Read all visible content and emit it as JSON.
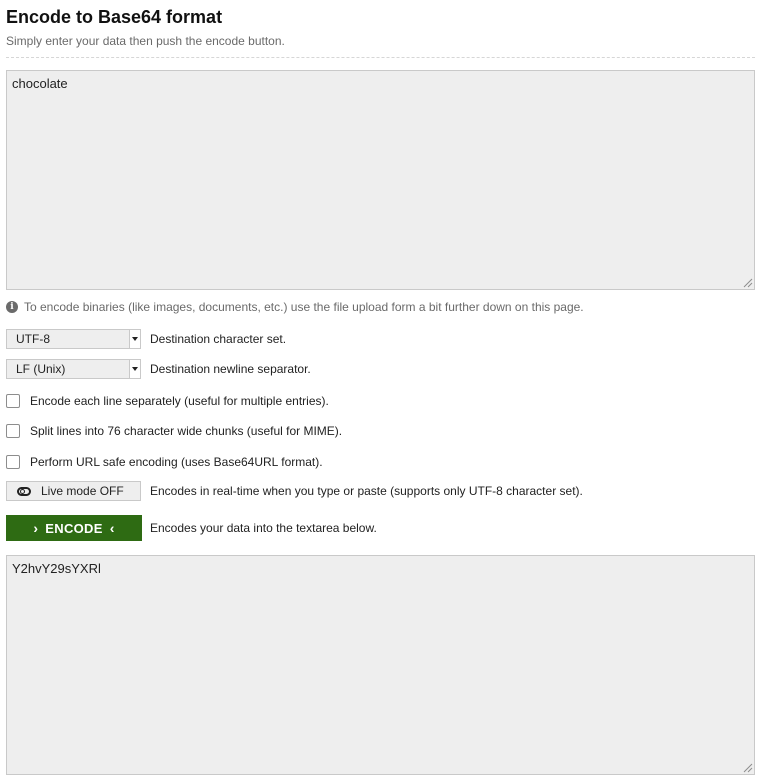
{
  "header": {
    "title": "Encode to Base64 format",
    "subtitle": "Simply enter your data then push the encode button."
  },
  "input": {
    "value": "chocolate"
  },
  "info": {
    "icon": "info-icon",
    "text": "To encode binaries (like images, documents, etc.) use the file upload form a bit further down on this page."
  },
  "options": {
    "charset": {
      "selected": "UTF-8",
      "label": "Destination character set."
    },
    "newline": {
      "selected": "LF (Unix)",
      "label": "Destination newline separator."
    },
    "each_line": {
      "checked": false,
      "label": "Encode each line separately (useful for multiple entries)."
    },
    "split_lines": {
      "checked": false,
      "label": "Split lines into 76 character wide chunks (useful for MIME)."
    },
    "url_safe": {
      "checked": false,
      "label": "Perform URL safe encoding (uses Base64URL format)."
    },
    "live_mode": {
      "button_label": "Live mode OFF",
      "label": "Encodes in real-time when you type or paste (supports only UTF-8 character set)."
    }
  },
  "encode": {
    "button_label": "ENCODE",
    "left_chevron": "›",
    "right_chevron": "‹",
    "label": "Encodes your data into the textarea below.",
    "color": "#2e6b13"
  },
  "output": {
    "value": "Y2hvY29sYXRl"
  }
}
